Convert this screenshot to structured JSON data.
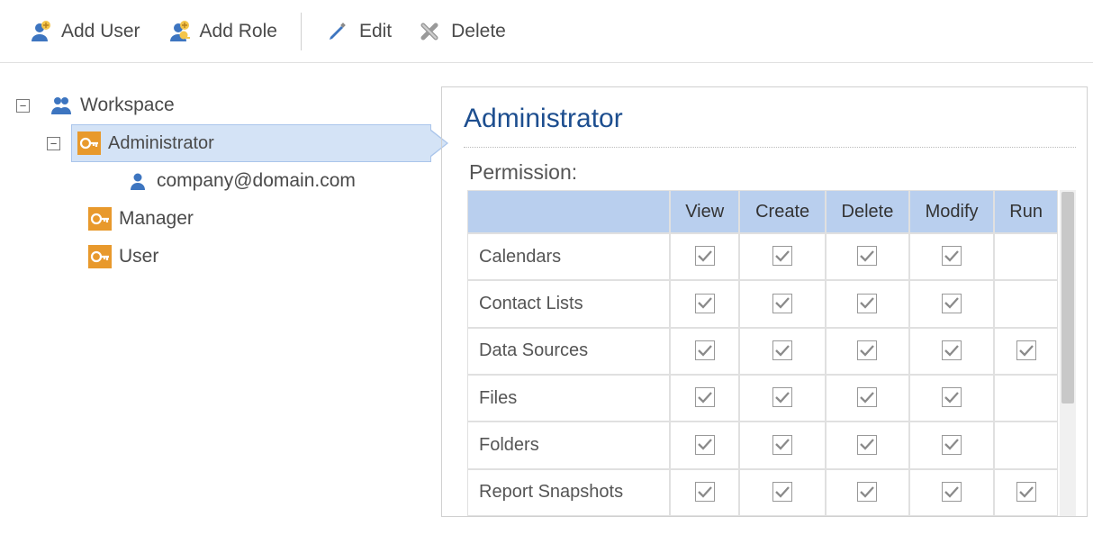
{
  "toolbar": {
    "add_user": "Add User",
    "add_role": "Add Role",
    "edit": "Edit",
    "delete": "Delete"
  },
  "tree": {
    "root": "Workspace",
    "admin": "Administrator",
    "admin_user": "company@domain.com",
    "manager": "Manager",
    "user": "User"
  },
  "detail": {
    "title": "Administrator",
    "permission_label": "Permission:",
    "columns": [
      "",
      "View",
      "Create",
      "Delete",
      "Modify",
      "Run"
    ],
    "rows": [
      {
        "name": "Calendars",
        "view": true,
        "create": true,
        "delete": true,
        "modify": true,
        "run": false
      },
      {
        "name": "Contact Lists",
        "view": true,
        "create": true,
        "delete": true,
        "modify": true,
        "run": false
      },
      {
        "name": "Data Sources",
        "view": true,
        "create": true,
        "delete": true,
        "modify": true,
        "run": true
      },
      {
        "name": "Files",
        "view": true,
        "create": true,
        "delete": true,
        "modify": true,
        "run": false
      },
      {
        "name": "Folders",
        "view": true,
        "create": true,
        "delete": true,
        "modify": true,
        "run": false
      },
      {
        "name": "Report Snapshots",
        "view": true,
        "create": true,
        "delete": true,
        "modify": true,
        "run": true
      }
    ]
  },
  "colors": {
    "orange": "#e8992c",
    "blue_light": "#b9cfee",
    "selection": "#d4e3f6",
    "title": "#1d4e8f"
  }
}
